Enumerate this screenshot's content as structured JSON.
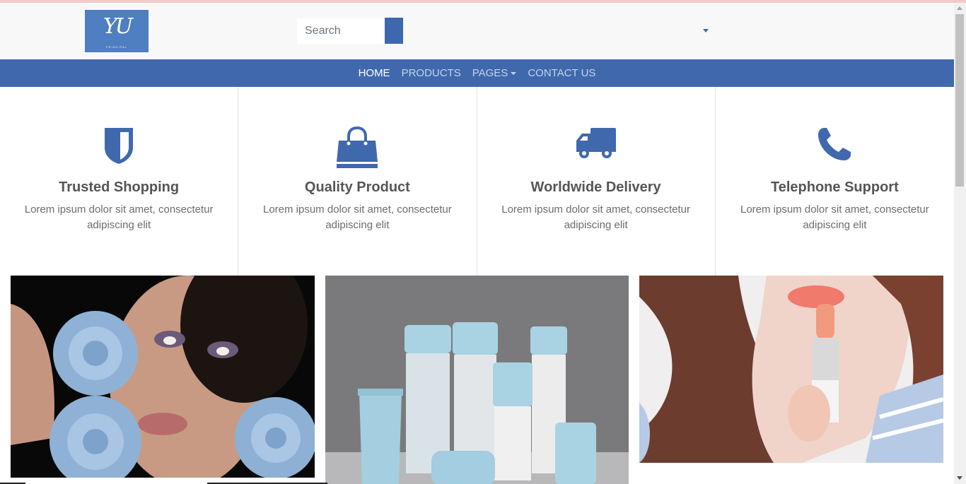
{
  "brand": {
    "logo_text": "YU",
    "logo_subtext": "PRINCIPAL",
    "accent": "#4069ad"
  },
  "search": {
    "placeholder": "Search"
  },
  "nav": {
    "items": [
      {
        "label": "HOME",
        "active": true
      },
      {
        "label": "PRODUCTS",
        "active": false
      },
      {
        "label": "PAGES",
        "active": false,
        "dropdown": true
      },
      {
        "label": "CONTACT US",
        "active": false
      }
    ]
  },
  "features": [
    {
      "icon": "shield-icon",
      "title": "Trusted Shopping",
      "desc": "Lorem ipsum dolor sit amet, consectetur adipiscing elit"
    },
    {
      "icon": "shopping-bag-icon",
      "title": "Quality Product",
      "desc": "Lorem ipsum dolor sit amet, consectetur adipiscing elit"
    },
    {
      "icon": "truck-icon",
      "title": "Worldwide Delivery",
      "desc": "Lorem ipsum dolor sit amet, consectetur adipiscing elit"
    },
    {
      "icon": "phone-icon",
      "title": "Telephone Support",
      "desc": "Lorem ipsum dolor sit amet, consectetur adipiscing elit"
    }
  ],
  "gallery": [
    {
      "name": "model-with-blue-roses-photo"
    },
    {
      "name": "skincare-bottles-photo"
    },
    {
      "name": "lipstick-model-photo"
    }
  ]
}
